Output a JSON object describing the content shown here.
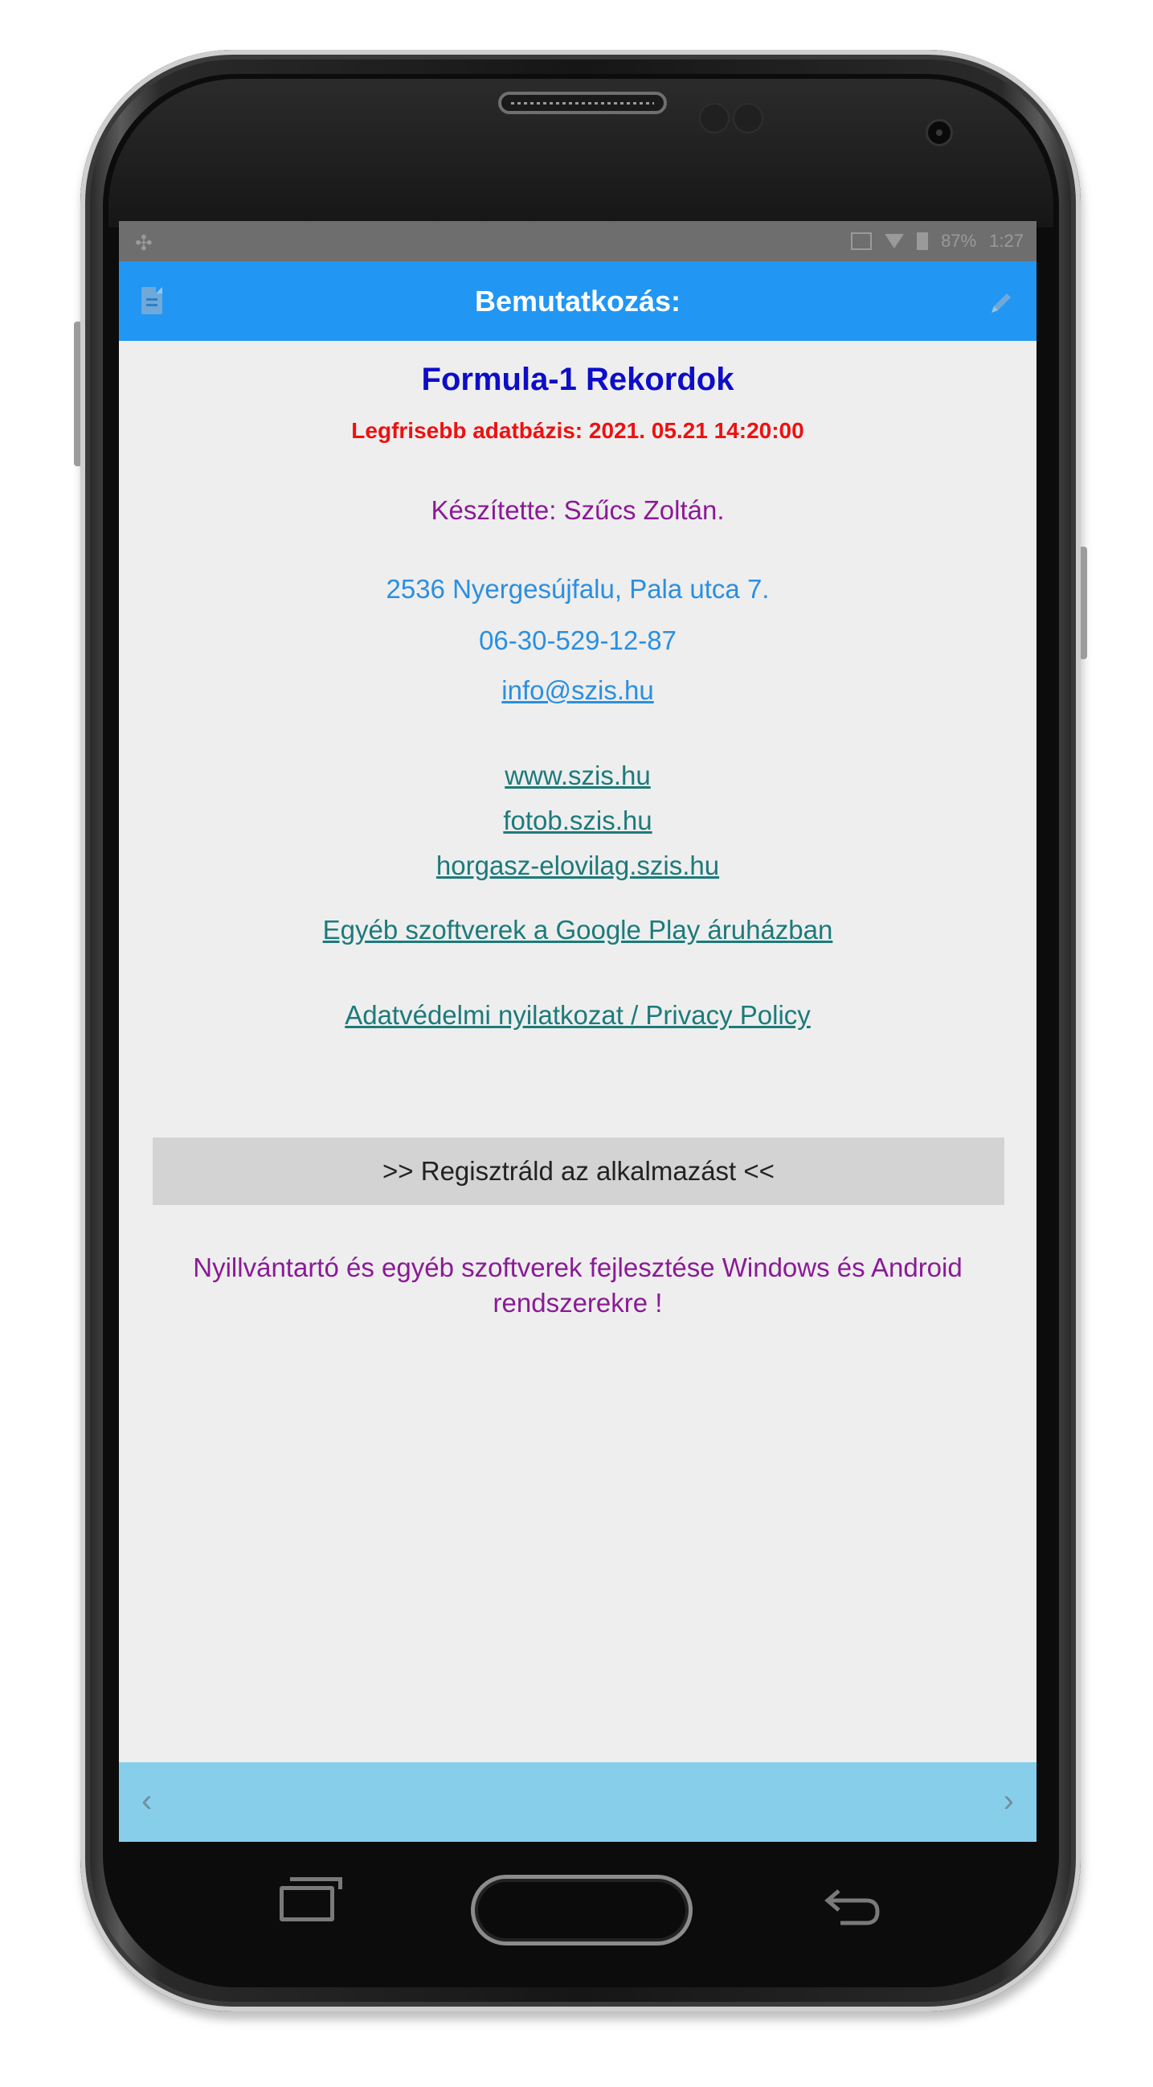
{
  "status_bar": {
    "left_icon": "gamepad-icon",
    "battery_percent": "87%",
    "time": "1:27"
  },
  "app_bar": {
    "title": "Bemutatkozás:",
    "left_icon": "document-icon",
    "right_icon": "pencil-icon"
  },
  "content": {
    "app_name": "Formula-1 Rekordok",
    "database_date": "Legfrisebb adatbázis: 2021. 05.21 14:20:00",
    "author": "Készítette: Szűcs Zoltán.",
    "address": "2536 Nyergesújfalu, Pala utca 7.",
    "phone": "06-30-529-12-87",
    "email": "info@szis.hu",
    "websites": [
      "www.szis.hu",
      "fotob.szis.hu",
      "horgasz-elovilag.szis.hu"
    ],
    "more_software_link": "Egyéb szoftverek a Google Play áruházban",
    "privacy_link": "Adatvédelmi nyilatkozat / Privacy Policy",
    "register_button": ">> Regisztráld az alkalmazást <<",
    "tagline": "Nyillvántartó és egyéb szoftverek fejlesztése Windows és Android rendszerekre !"
  },
  "bottom_bar": {
    "prev_label": "‹",
    "next_label": "›"
  },
  "colors": {
    "app_bar": "#2196f3",
    "bottom_bar": "#87ceea",
    "title_blue": "#0d0dc8",
    "date_red": "#ee1111",
    "purple": "#8b1a96",
    "contact_blue": "#2a8fe0",
    "link_teal": "#1d7a7a"
  }
}
